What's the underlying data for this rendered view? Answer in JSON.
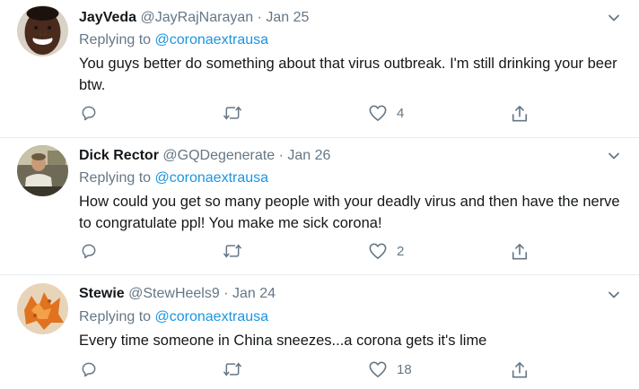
{
  "tweets": [
    {
      "name": "JayVeda",
      "handle": "@JayRajNarayan",
      "separator": "·",
      "date": "Jan 25",
      "replying_prefix": "Replying to",
      "replying_to": "@coronaextrausa",
      "text": "You guys better do something about that virus outbreak. I'm still drinking your beer btw.",
      "reply_count": "",
      "retweet_count": "",
      "like_count": "4",
      "avatar": "avatar-smiling-man",
      "icons": [
        "reply-icon",
        "retweet-icon",
        "like-icon",
        "share-icon",
        "chevron-down-icon"
      ]
    },
    {
      "name": "Dick Rector",
      "handle": "@GQDegenerate",
      "separator": "·",
      "date": "Jan 26",
      "replying_prefix": "Replying to",
      "replying_to": "@coronaextrausa",
      "text": "How could you get so many people with your deadly virus and then have the nerve to congratulate ppl! You make me sick corona!",
      "reply_count": "",
      "retweet_count": "",
      "like_count": "2",
      "avatar": "avatar-man-at-desk",
      "icons": [
        "reply-icon",
        "retweet-icon",
        "like-icon",
        "share-icon",
        "chevron-down-icon"
      ]
    },
    {
      "name": "Stewie",
      "handle": "@StewHeels9",
      "separator": "·",
      "date": "Jan 24",
      "replying_prefix": "Replying to",
      "replying_to": "@coronaextrausa",
      "text": "Every time someone in China sneezes...a corona gets it's lime",
      "reply_count": "",
      "retweet_count": "",
      "like_count": "18",
      "avatar": "avatar-orange-food",
      "icons": [
        "reply-icon",
        "retweet-icon",
        "like-icon",
        "share-icon",
        "chevron-down-icon"
      ]
    }
  ],
  "colors": {
    "text": "#14171a",
    "muted": "#657786",
    "link": "#1b95e0",
    "divider": "#e6ecf0"
  }
}
